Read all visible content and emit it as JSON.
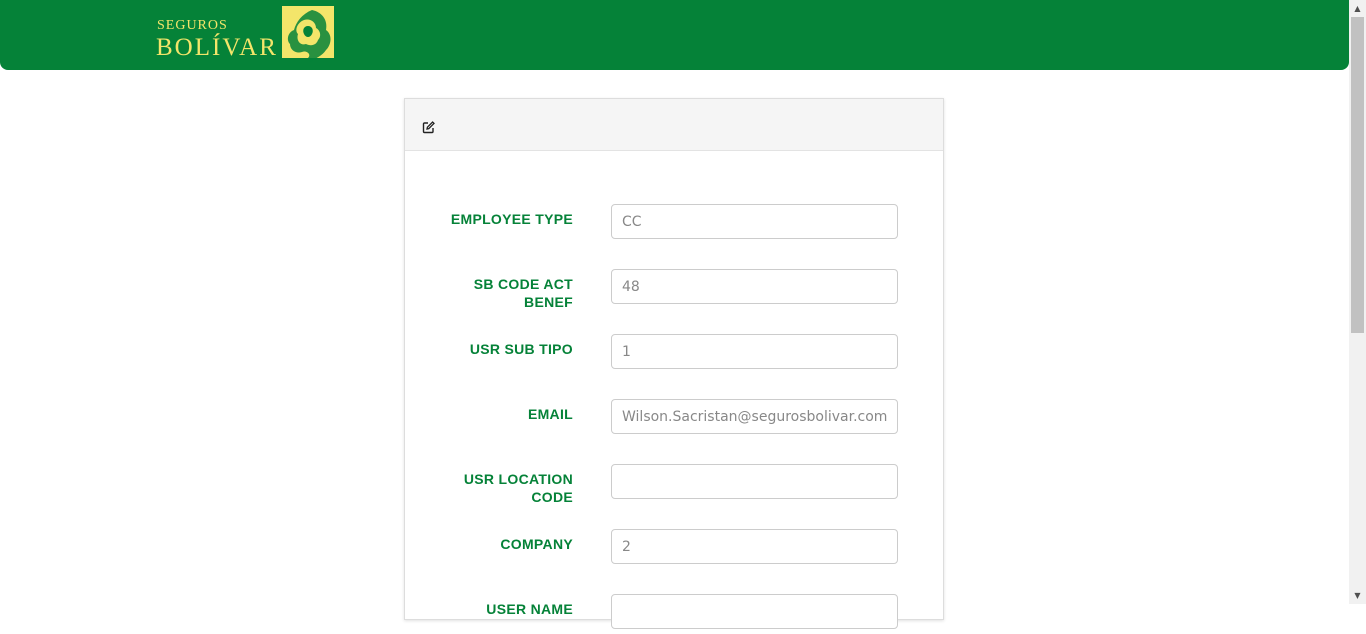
{
  "brand": {
    "top": "SEGUROS",
    "name": "BOLÍVAR",
    "color": "#f3e56a",
    "header_color": "#058238"
  },
  "panel": {
    "header_icon": "edit-icon",
    "fields": [
      {
        "label": "EMPLOYEE TYPE",
        "placeholder": "CC"
      },
      {
        "label": "SB CODE ACT BENEF",
        "placeholder": "48"
      },
      {
        "label": "USR SUB TIPO",
        "placeholder": "1"
      },
      {
        "label": "EMAIL",
        "placeholder": "Wilson.Sacristan@segurosbolivar.com"
      },
      {
        "label": "USR LOCATION CODE",
        "placeholder": ""
      },
      {
        "label": "COMPANY",
        "placeholder": "2"
      },
      {
        "label": "USER NAME",
        "placeholder": ""
      }
    ]
  }
}
